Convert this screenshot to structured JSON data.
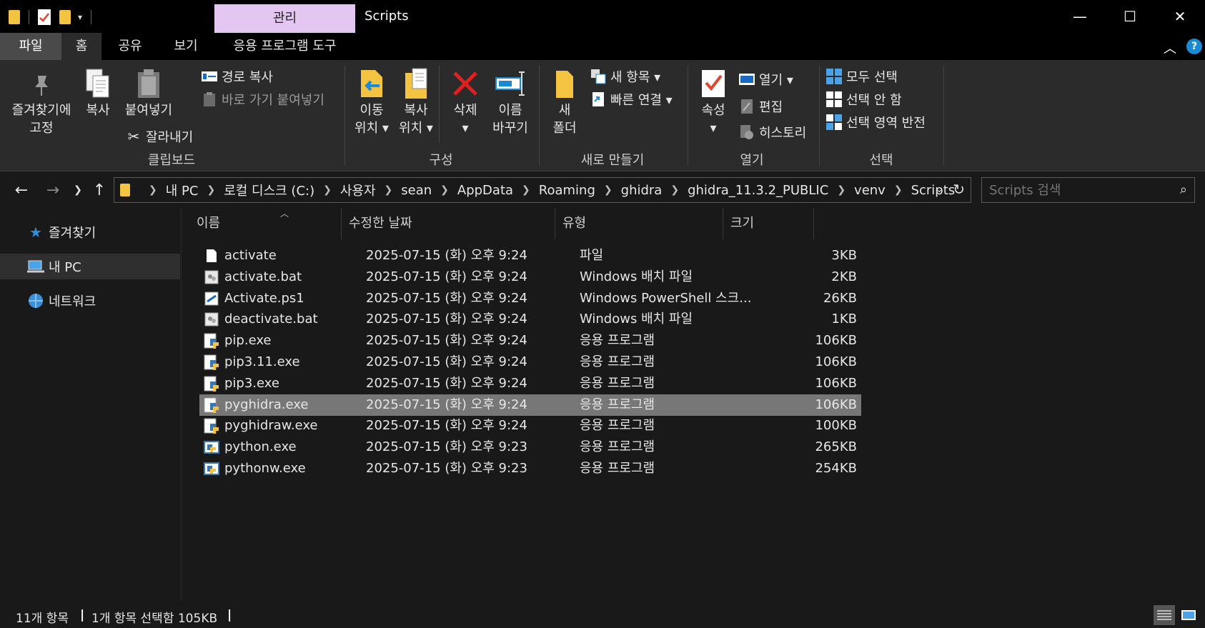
{
  "window": {
    "title": "Scripts",
    "context_tab": "관리",
    "minimize": "—",
    "maximize": "☐",
    "close": "✕"
  },
  "ribbon_tabs": [
    "파일",
    "홈",
    "공유",
    "보기",
    "응용 프로그램 도구"
  ],
  "ribbon": {
    "clipboard": {
      "pin": "즐겨찾기에\n고정",
      "copy": "복사",
      "paste": "붙여넣기",
      "copy_path": "경로 복사",
      "paste_shortcut": "바로 가기 붙여넣기",
      "cut": "잘라내기",
      "label": "클립보드"
    },
    "organize": {
      "move_to": "이동\n위치 ▾",
      "copy_to": "복사\n위치 ▾",
      "delete": "삭제\n▾",
      "rename": "이름\n바꾸기",
      "label": "구성"
    },
    "new": {
      "new_folder": "새\n폴더",
      "new_item": "새 항목 ▾",
      "easy_access": "빠른 연결 ▾",
      "label": "새로 만들기"
    },
    "open": {
      "properties": "속성\n▾",
      "open": "열기 ▾",
      "edit": "편집",
      "history": "히스토리",
      "label": "열기"
    },
    "select": {
      "select_all": "모두 선택",
      "select_none": "선택 안 함",
      "invert": "선택 영역 반전",
      "label": "선택"
    }
  },
  "breadcrumb": [
    "내 PC",
    "로컬 디스크 (C:)",
    "사용자",
    "sean",
    "AppData",
    "Roaming",
    "ghidra",
    "ghidra_11.3.2_PUBLIC",
    "venv",
    "Scripts"
  ],
  "search": {
    "placeholder": "Scripts 검색"
  },
  "nav_pane": [
    {
      "label": "즐겨찾기",
      "icon": "star-icon"
    },
    {
      "label": "내 PC",
      "icon": "pc-icon",
      "selected": true
    },
    {
      "label": "네트워크",
      "icon": "network-icon"
    }
  ],
  "columns": {
    "name": "이름",
    "date": "수정한 날짜",
    "type": "유형",
    "size": "크기"
  },
  "files": [
    {
      "name": "activate",
      "date": "2025-07-15 (화) 오후 9:24",
      "type": "파일",
      "size": "3KB",
      "icon": "file-icon"
    },
    {
      "name": "activate.bat",
      "date": "2025-07-15 (화) 오후 9:24",
      "type": "Windows 배치 파일",
      "size": "2KB",
      "icon": "batch-file-icon"
    },
    {
      "name": "Activate.ps1",
      "date": "2025-07-15 (화) 오후 9:24",
      "type": "Windows PowerShell 스크...",
      "size": "26KB",
      "icon": "powershell-file-icon"
    },
    {
      "name": "deactivate.bat",
      "date": "2025-07-15 (화) 오후 9:24",
      "type": "Windows 배치 파일",
      "size": "1KB",
      "icon": "batch-file-icon"
    },
    {
      "name": "pip.exe",
      "date": "2025-07-15 (화) 오후 9:24",
      "type": "응용 프로그램",
      "size": "106KB",
      "icon": "python-exe-icon"
    },
    {
      "name": "pip3.11.exe",
      "date": "2025-07-15 (화) 오후 9:24",
      "type": "응용 프로그램",
      "size": "106KB",
      "icon": "python-exe-icon"
    },
    {
      "name": "pip3.exe",
      "date": "2025-07-15 (화) 오후 9:24",
      "type": "응용 프로그램",
      "size": "106KB",
      "icon": "python-exe-icon"
    },
    {
      "name": "pyghidra.exe",
      "date": "2025-07-15 (화) 오후 9:24",
      "type": "응용 프로그램",
      "size": "106KB",
      "icon": "python-exe-icon",
      "selected": true
    },
    {
      "name": "pyghidraw.exe",
      "date": "2025-07-15 (화) 오후 9:24",
      "type": "응용 프로그램",
      "size": "100KB",
      "icon": "python-exe-icon"
    },
    {
      "name": "python.exe",
      "date": "2025-07-15 (화) 오후 9:23",
      "type": "응용 프로그램",
      "size": "265KB",
      "icon": "python-app-icon"
    },
    {
      "name": "pythonw.exe",
      "date": "2025-07-15 (화) 오후 9:23",
      "type": "응용 프로그램",
      "size": "254KB",
      "icon": "python-app-icon"
    }
  ],
  "status": {
    "count": "11개 항목",
    "selection": "1개 항목 선택함 105KB"
  },
  "colors": {
    "background": "#191919",
    "ribbon": "#2b2b2b",
    "context_tab": "#e3c7f0",
    "selected_row": "#777777",
    "folder": "#f5c342",
    "accent_blue": "#1a8ad4"
  }
}
